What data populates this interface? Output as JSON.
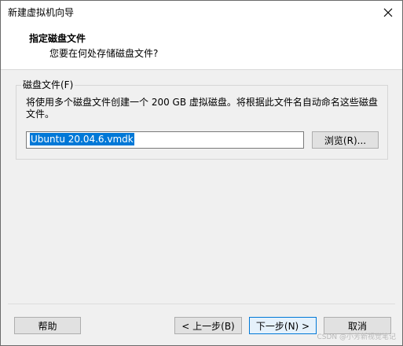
{
  "window": {
    "title": "新建虚拟机向导"
  },
  "header": {
    "title": "指定磁盘文件",
    "subtitle": "您要在何处存储磁盘文件?"
  },
  "disk_file_group": {
    "label": "磁盘文件(F)",
    "description": "将使用多个磁盘文件创建一个 200 GB 虚拟磁盘。将根据此文件名自动命名这些磁盘文件。",
    "file_name_value": "Ubuntu 20.04.6.vmdk",
    "browse_label": "浏览(R)..."
  },
  "footer": {
    "help_label": "帮助",
    "back_label": "< 上一步(B)",
    "next_label": "下一步(N) >",
    "cancel_label": "取消"
  },
  "watermark": "CSDN @小芳新视觉笔记",
  "icons": {
    "close": "close-icon"
  },
  "colors": {
    "selection": "#0078d7",
    "default_button_border": "#0078d7"
  }
}
